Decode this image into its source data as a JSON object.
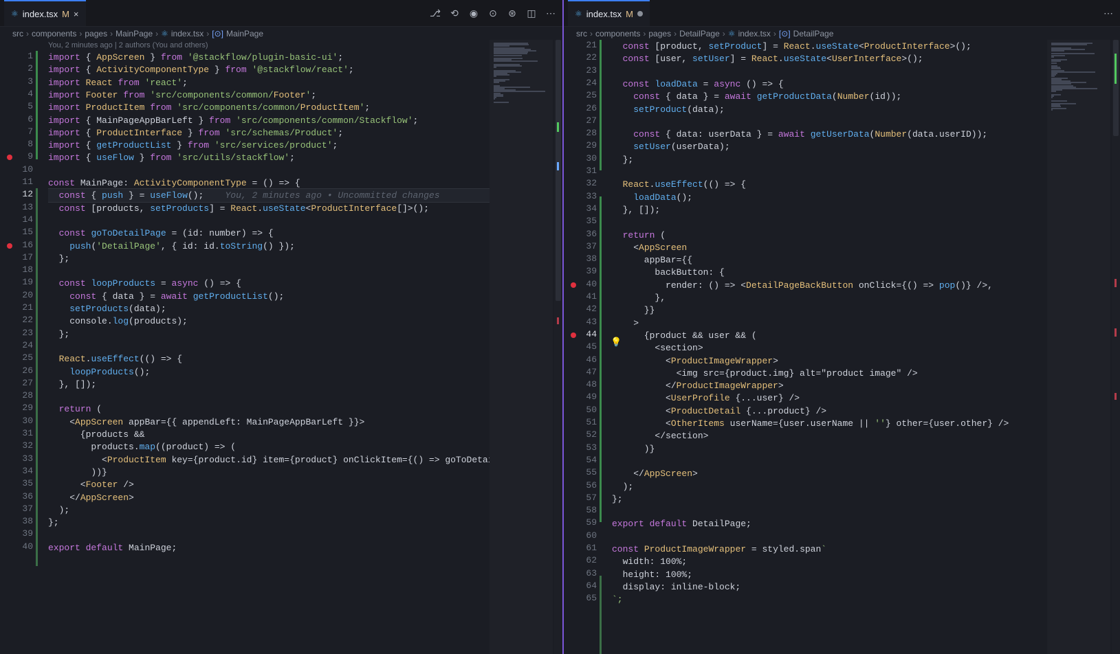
{
  "left": {
    "tab": {
      "icon": "react-icon",
      "name": "index.tsx",
      "status": "M",
      "close": "×"
    },
    "actions": [
      "source-control-icon",
      "timeline-back-icon",
      "commit-icon",
      "compare-icon",
      "run-icon",
      "split-editor-icon",
      "more-icon"
    ],
    "breadcrumb": [
      "src",
      "components",
      "pages",
      "MainPage",
      "index.tsx",
      "MainPage"
    ],
    "blame": "You, 2 minutes ago | 2 authors (You and others)",
    "ghost": "You, 2 minutes ago • Uncommitted changes",
    "lines": [
      {
        "n": "1",
        "text": "import { AppScreen } from '@stackflow/plugin-basic-ui';"
      },
      {
        "n": "2",
        "text": "import { ActivityComponentType } from '@stackflow/react';"
      },
      {
        "n": "3",
        "text": "import React from 'react';"
      },
      {
        "n": "4",
        "text": "import Footer from 'src/components/common/Footer';"
      },
      {
        "n": "5",
        "text": "import ProductItem from 'src/components/common/ProductItem';"
      },
      {
        "n": "6",
        "text": "import { MainPageAppBarLeft } from 'src/components/common/Stackflow';"
      },
      {
        "n": "7",
        "text": "import { ProductInterface } from 'src/schemas/Product';"
      },
      {
        "n": "8",
        "text": "import { getProductList } from 'src/services/product';"
      },
      {
        "n": "9",
        "text": "import { useFlow } from 'src/utils/stackflow';"
      },
      {
        "n": "10",
        "text": ""
      },
      {
        "n": "11",
        "text": "const MainPage: ActivityComponentType = () => {"
      },
      {
        "n": "12",
        "text": "  const { push } = useFlow();"
      },
      {
        "n": "13",
        "text": "  const [products, setProducts] = React.useState<ProductInterface[]>();"
      },
      {
        "n": "14",
        "text": ""
      },
      {
        "n": "15",
        "text": "  const goToDetailPage = (id: number) => {"
      },
      {
        "n": "16",
        "text": "    push('DetailPage', { id: id.toString() });"
      },
      {
        "n": "17",
        "text": "  };"
      },
      {
        "n": "18",
        "text": ""
      },
      {
        "n": "19",
        "text": "  const loopProducts = async () => {"
      },
      {
        "n": "20",
        "text": "    const { data } = await getProductList();"
      },
      {
        "n": "21",
        "text": "    setProducts(data);"
      },
      {
        "n": "22",
        "text": "    console.log(products);"
      },
      {
        "n": "23",
        "text": "  };"
      },
      {
        "n": "24",
        "text": ""
      },
      {
        "n": "25",
        "text": "  React.useEffect(() => {"
      },
      {
        "n": "26",
        "text": "    loopProducts();"
      },
      {
        "n": "27",
        "text": "  }, []);"
      },
      {
        "n": "28",
        "text": ""
      },
      {
        "n": "29",
        "text": "  return ("
      },
      {
        "n": "30",
        "text": "    <AppScreen appBar={{ appendLeft: MainPageAppBarLeft }}>"
      },
      {
        "n": "31",
        "text": "      {products &&"
      },
      {
        "n": "32",
        "text": "        products.map((product) => ("
      },
      {
        "n": "33",
        "text": "          <ProductItem key={product.id} item={product} onClickItem={() => goToDetai"
      },
      {
        "n": "34",
        "text": "        ))}"
      },
      {
        "n": "35",
        "text": "      <Footer />"
      },
      {
        "n": "36",
        "text": "    </AppScreen>"
      },
      {
        "n": "37",
        "text": "  );"
      },
      {
        "n": "38",
        "text": "};"
      },
      {
        "n": "39",
        "text": ""
      },
      {
        "n": "40",
        "text": "export default MainPage;"
      }
    ]
  },
  "right": {
    "tab": {
      "icon": "react-icon",
      "name": "index.tsx",
      "status": "M"
    },
    "actions": [
      "more-icon"
    ],
    "breadcrumb": [
      "src",
      "components",
      "pages",
      "DetailPage",
      "index.tsx",
      "DetailPage"
    ],
    "lines": [
      {
        "n": "21",
        "text": "  const [product, setProduct] = React.useState<ProductInterface>();"
      },
      {
        "n": "22",
        "text": "  const [user, setUser] = React.useState<UserInterface>();"
      },
      {
        "n": "23",
        "text": ""
      },
      {
        "n": "24",
        "text": "  const loadData = async () => {"
      },
      {
        "n": "25",
        "text": "    const { data } = await getProductData(Number(id));"
      },
      {
        "n": "26",
        "text": "    setProduct(data);"
      },
      {
        "n": "27",
        "text": ""
      },
      {
        "n": "28",
        "text": "    const { data: userData } = await getUserData(Number(data.userID));"
      },
      {
        "n": "29",
        "text": "    setUser(userData);"
      },
      {
        "n": "30",
        "text": "  };"
      },
      {
        "n": "31",
        "text": ""
      },
      {
        "n": "32",
        "text": "  React.useEffect(() => {"
      },
      {
        "n": "33",
        "text": "    loadData();"
      },
      {
        "n": "34",
        "text": "  }, []);"
      },
      {
        "n": "35",
        "text": ""
      },
      {
        "n": "36",
        "text": "  return ("
      },
      {
        "n": "37",
        "text": "    <AppScreen"
      },
      {
        "n": "38",
        "text": "      appBar={{"
      },
      {
        "n": "39",
        "text": "        backButton: {"
      },
      {
        "n": "40",
        "text": "          render: () => <DetailPageBackButton onClick={() => pop()} />,"
      },
      {
        "n": "41",
        "text": "        },"
      },
      {
        "n": "42",
        "text": "      }}"
      },
      {
        "n": "43",
        "text": "    >"
      },
      {
        "n": "44",
        "text": "      {product && user && ("
      },
      {
        "n": "45",
        "text": "        <section>"
      },
      {
        "n": "46",
        "text": "          <ProductImageWrapper>"
      },
      {
        "n": "47",
        "text": "            <img src={product.img} alt=\"product image\" />"
      },
      {
        "n": "48",
        "text": "          </ProductImageWrapper>"
      },
      {
        "n": "49",
        "text": "          <UserProfile {...user} />"
      },
      {
        "n": "50",
        "text": "          <ProductDetail {...product} />"
      },
      {
        "n": "51",
        "text": "          <OtherItems userName={user.userName || ''} other={user.other} />"
      },
      {
        "n": "52",
        "text": "        </section>"
      },
      {
        "n": "53",
        "text": "      )}"
      },
      {
        "n": "54",
        "text": ""
      },
      {
        "n": "55",
        "text": "    </AppScreen>"
      },
      {
        "n": "56",
        "text": "  );"
      },
      {
        "n": "57",
        "text": "};"
      },
      {
        "n": "58",
        "text": ""
      },
      {
        "n": "59",
        "text": "export default DetailPage;"
      },
      {
        "n": "60",
        "text": ""
      },
      {
        "n": "61",
        "text": "const ProductImageWrapper = styled.span`"
      },
      {
        "n": "62",
        "text": "  width: 100%;"
      },
      {
        "n": "63",
        "text": "  height: 100%;"
      },
      {
        "n": "64",
        "text": "  display: inline-block;"
      },
      {
        "n": "65",
        "text": "`;"
      }
    ]
  },
  "colors": {
    "accent": "#3c7ff3",
    "breakpoint": "#e0303e",
    "modified": "#e2c08d",
    "divider": "#7b56d9"
  }
}
